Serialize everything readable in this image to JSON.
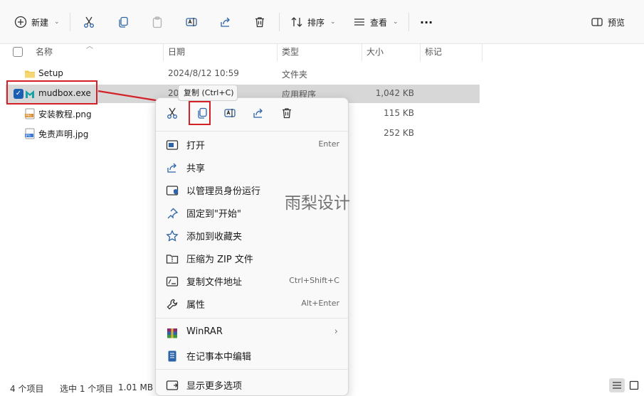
{
  "toolbar": {
    "new_label": "新建",
    "sort_label": "排序",
    "view_label": "查看",
    "more_label": "···",
    "preview_label": "预览"
  },
  "columns": {
    "name": "名称",
    "date": "日期",
    "type": "类型",
    "size": "大小",
    "tags": "标记"
  },
  "files": [
    {
      "name": "Setup",
      "date": "2024/8/12 10:59",
      "type": "文件夹",
      "size": "",
      "icon": "folder-icon"
    },
    {
      "name": "mudbox.exe",
      "date": "20",
      "type": "应用程序",
      "size": "1,042 KB",
      "icon": "app-icon"
    },
    {
      "name": "安装教程.png",
      "date": "",
      "type": "",
      "size": "115 KB",
      "icon": "png-file-icon"
    },
    {
      "name": "免责声明.jpg",
      "date": "",
      "type": "",
      "size": "252 KB",
      "icon": "jpg-file-icon"
    }
  ],
  "tooltip": "复制 (Ctrl+C)",
  "menu": {
    "items": [
      {
        "label": "打开",
        "shortcut": "Enter"
      },
      {
        "label": "共享",
        "shortcut": ""
      },
      {
        "label": "以管理员身份运行",
        "shortcut": ""
      },
      {
        "label": "固定到\"开始\"",
        "shortcut": ""
      },
      {
        "label": "添加到收藏夹",
        "shortcut": ""
      },
      {
        "label": "压缩为 ZIP 文件",
        "shortcut": ""
      },
      {
        "label": "复制文件地址",
        "shortcut": "Ctrl+Shift+C"
      },
      {
        "label": "属性",
        "shortcut": "Alt+Enter"
      },
      {
        "label": "WinRAR",
        "shortcut": ""
      },
      {
        "label": "在记事本中编辑",
        "shortcut": ""
      },
      {
        "label": "显示更多选项",
        "shortcut": ""
      }
    ]
  },
  "watermark": "雨梨设计",
  "status": {
    "count": "4 个项目",
    "selected": "选中 1 个项目",
    "size": "1.01 MB"
  },
  "colors": {
    "highlight": "#d42027",
    "selection": "#d7d7d7",
    "accent": "#1a5fb4"
  }
}
